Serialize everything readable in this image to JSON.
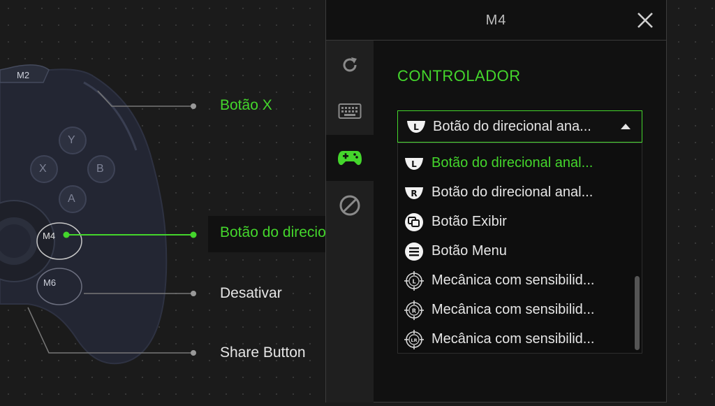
{
  "controller": {
    "badges": {
      "m2": "M2",
      "m4": "M4",
      "m6": "M6"
    },
    "face_buttons": {
      "y": "Y",
      "x": "X",
      "b": "B",
      "a": "A"
    },
    "mappings": [
      {
        "label": "Botão X"
      },
      {
        "label": "Botão do direcional analógico esquerdo"
      },
      {
        "label": "Desativar"
      },
      {
        "label": "Share Button"
      }
    ]
  },
  "panel": {
    "title": "M4",
    "section_title": "CONTROLADOR",
    "sidebar": [
      "refresh-icon",
      "keyboard-icon",
      "gamepad-icon",
      "disable-icon"
    ],
    "dropdown": {
      "selected_badge": "L",
      "selected_label": "Botão do direcional ana..."
    },
    "options": [
      {
        "badge": "L",
        "label": "Botão do direcional anal...",
        "selected": true
      },
      {
        "badge": "R",
        "label": "Botão do direcional anal..."
      },
      {
        "icon": "view-icon",
        "label": "Botão Exibir"
      },
      {
        "icon": "menu-icon",
        "label": "Botão Menu"
      },
      {
        "badge": "L",
        "icon": "target-icon",
        "label": "Mecânica com sensibilid..."
      },
      {
        "badge": "R",
        "icon": "target-icon",
        "label": "Mecânica com sensibilid..."
      },
      {
        "badge": "LR",
        "icon": "target-icon",
        "label": "Mecânica com sensibilid..."
      }
    ]
  },
  "colors": {
    "accent": "#44d62c",
    "panel_bg": "#111111",
    "sidebar_bg": "#1f1f1f"
  }
}
